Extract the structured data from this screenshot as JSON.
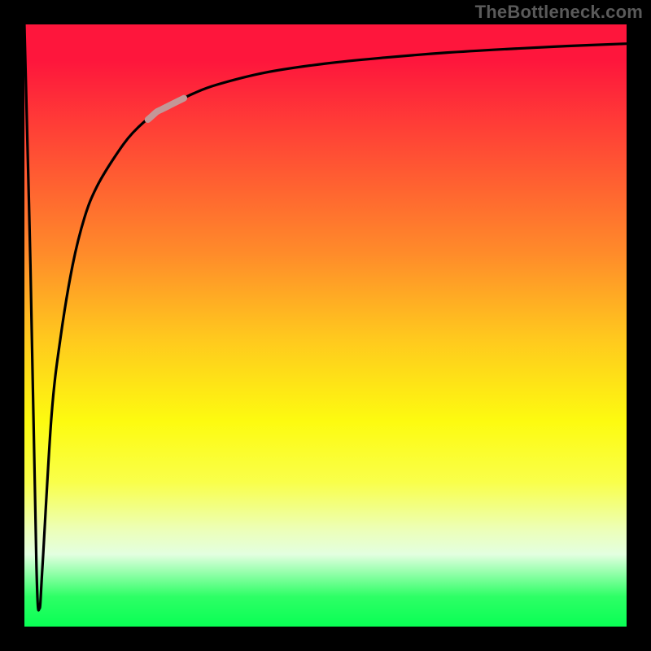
{
  "watermark": "TheBottleneck.com",
  "colors": {
    "frame": "#000000",
    "watermark": "#5a5a5a",
    "curve_main": "#000000",
    "curve_highlight": "#c39797",
    "gradient_top": "#fe163c",
    "gradient_bottom": "#09ff54"
  },
  "chart_data": {
    "type": "line",
    "title": "",
    "xlabel": "",
    "ylabel": "",
    "xlim": [
      0,
      100
    ],
    "ylim": [
      0,
      100
    ],
    "grid": false,
    "legend": false,
    "series": [
      {
        "name": "bottleneck-curve",
        "x": [
          0,
          1,
          2.0,
          2.5,
          3.0,
          4.5,
          6,
          8,
          10,
          12,
          15,
          18,
          22,
          25,
          28,
          32,
          40,
          50,
          60,
          70,
          80,
          90,
          100
        ],
        "values": [
          100,
          60,
          10,
          3,
          10,
          35,
          48,
          60,
          68,
          73,
          78,
          82,
          85.5,
          87,
          88.5,
          90,
          92,
          93.5,
          94.5,
          95.3,
          95.9,
          96.4,
          96.8
        ]
      }
    ],
    "highlight_segment": {
      "series": "bottleneck-curve",
      "x_start": 20.5,
      "x_end": 26.5
    }
  }
}
